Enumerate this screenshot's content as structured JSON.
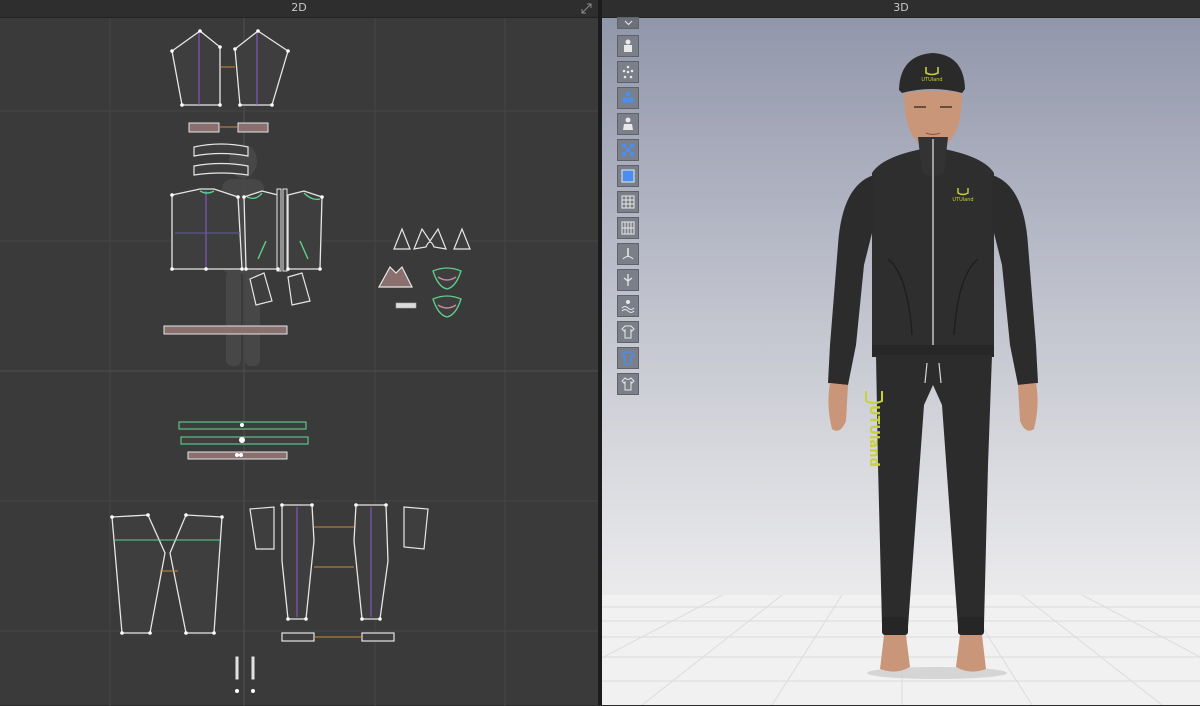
{
  "panels": {
    "left_title": "2D",
    "right_title": "3D"
  },
  "icons": {
    "expand": "expand-diagonal-icon",
    "collapse": "chevron-down-icon",
    "tools": [
      "avatar-display-icon",
      "skeleton-points-icon",
      "arrangement-points-icon",
      "avatar-silhouette-icon",
      "pattern-points-icon",
      "texture-surface-icon",
      "mesh-grid-icon",
      "grid-icon",
      "pressure-gauge-icon",
      "strain-icon",
      "stress-map-icon",
      "garment-outline-icon",
      "garment-selected-icon",
      "garment-shirt-icon"
    ]
  },
  "garment": {
    "logo_text": "UTUland",
    "logo_color": "#c8d23a"
  },
  "colors": {
    "pattern_outline": "#e6e6e6",
    "pattern_fill": "#3e3e3e",
    "seam_orange": "#c88a3c",
    "seam_green": "#5fd08c",
    "seam_purple": "#8a5fd0",
    "binding_fill": "#8a6f6f"
  }
}
